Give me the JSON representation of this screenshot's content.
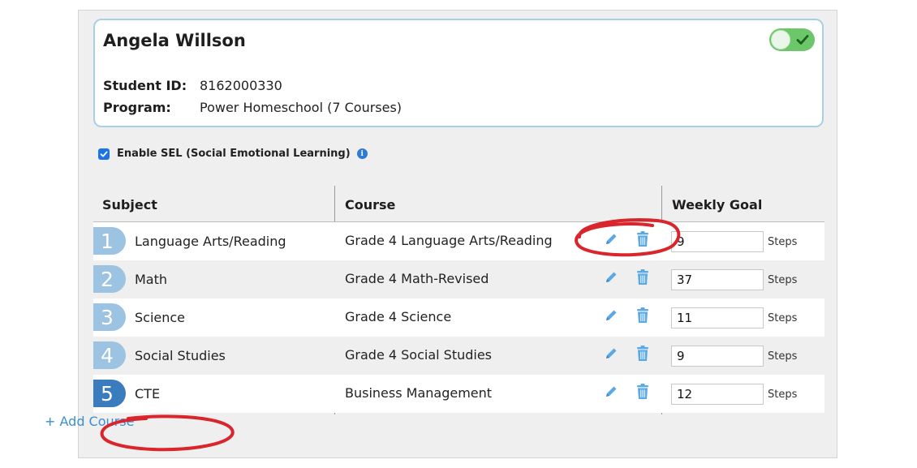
{
  "student": {
    "name": "Angela Willson",
    "id_label": "Student ID:",
    "id_value": "8162000330",
    "program_label": "Program:",
    "program_value": "Power Homeschool (7 Courses)"
  },
  "sel": {
    "label": "Enable SEL (Social Emotional Learning)",
    "checked": true
  },
  "table": {
    "headers": [
      "Subject",
      "Course",
      "Weekly Goal"
    ],
    "rows": [
      {
        "num": "1",
        "subject": "Language Arts/Reading",
        "course": "Grade 4 Language Arts/Reading",
        "goal": "9",
        "unit": "Steps"
      },
      {
        "num": "2",
        "subject": "Math",
        "course": "Grade 4 Math-Revised",
        "goal": "37",
        "unit": "Steps"
      },
      {
        "num": "3",
        "subject": "Science",
        "course": "Grade 4 Science",
        "goal": "11",
        "unit": "Steps"
      },
      {
        "num": "4",
        "subject": "Social Studies",
        "course": "Grade 4 Social Studies",
        "goal": "9",
        "unit": "Steps"
      },
      {
        "num": "5",
        "subject": "CTE",
        "course": "Business Management",
        "goal": "12",
        "unit": "Steps"
      }
    ]
  },
  "add_course_label": "+ Add Course",
  "colors": {
    "badge_light": "#9cc3e2",
    "badge_dark": "#3a7cbd",
    "icon_blue": "#5aa8e4",
    "toggle_on": "#6cc66a",
    "annotation_red": "#d9262c"
  }
}
